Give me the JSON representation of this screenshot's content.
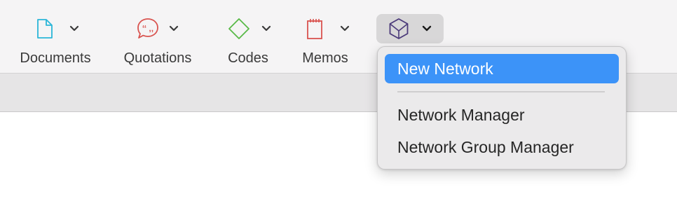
{
  "toolbar": {
    "items": [
      {
        "label": "Documents",
        "icon": "document-icon",
        "color": "#2bb6d8"
      },
      {
        "label": "Quotations",
        "icon": "quotation-icon",
        "color": "#d9534f"
      },
      {
        "label": "Codes",
        "icon": "code-diamond-icon",
        "color": "#58b947"
      },
      {
        "label": "Memos",
        "icon": "memo-icon",
        "color": "#d9534f"
      },
      {
        "label": "",
        "icon": "network-icon",
        "color": "#4b3a7a"
      }
    ]
  },
  "network_menu": {
    "items": [
      {
        "label": "New Network",
        "selected": true
      },
      {
        "label": "Network Manager",
        "selected": false
      },
      {
        "label": "Network Group Manager",
        "selected": false
      }
    ],
    "accent_color": "#3c93f8"
  }
}
